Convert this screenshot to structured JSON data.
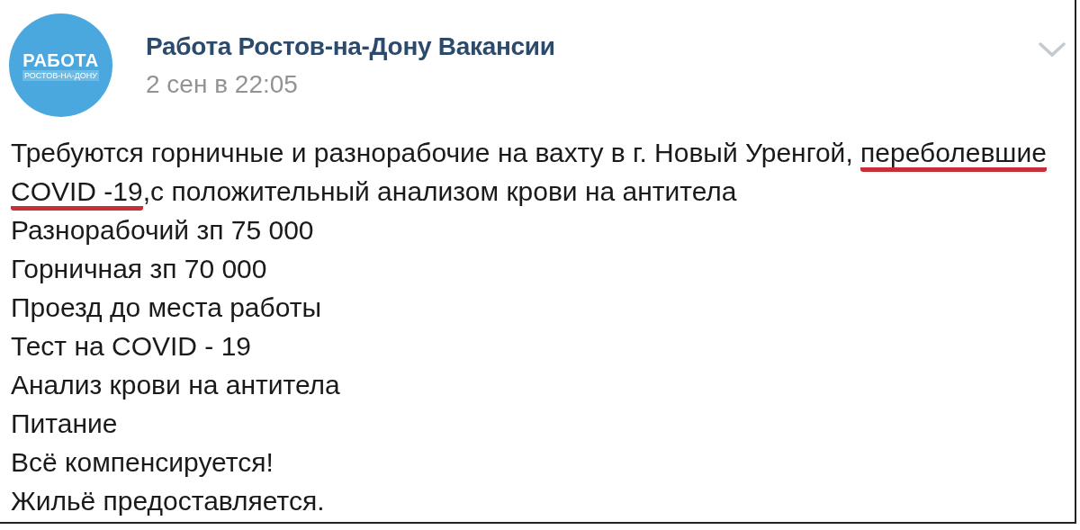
{
  "post": {
    "avatar": {
      "line_1": "РАБОТА",
      "line_2": "РОСТОВ-НА-ДОНУ"
    },
    "author": "Работа Ростов-на-Дону Вакансии",
    "date": "2 сен в 22:05",
    "paragraph": [
      {
        "text": "Требуются горничные и разнорабочие на вахту в г. Новый Уренгой, ",
        "underlined": false
      },
      {
        "text": "переболевшие COVID -19",
        "underlined": true
      },
      {
        "text": ",с положительный анализом крови на антитела",
        "underlined": false
      }
    ],
    "lines": [
      "Разнорабочий зп 75 000",
      "Горничная зп 70 000",
      "Проезд до места работы",
      "Тест на COVID - 19",
      "Анализ крови на антитела",
      "Питание",
      "Всё компенсируется!",
      "Жильё предоставляется."
    ]
  }
}
